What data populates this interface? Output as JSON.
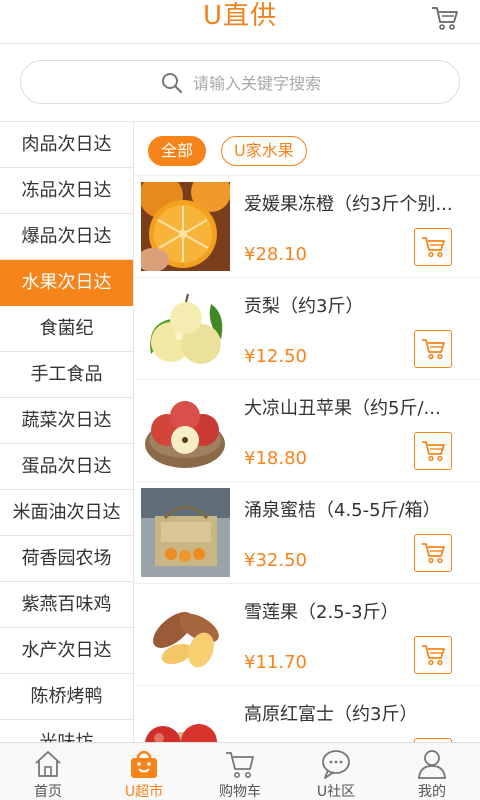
{
  "header": {
    "logo_text": "U直供",
    "cart_icon": "cart-icon"
  },
  "search": {
    "placeholder": "请输入关键字搜索",
    "icon": "search-icon"
  },
  "sidebar": {
    "active_index": 3,
    "items": [
      {
        "label": "肉品次日达"
      },
      {
        "label": "冻品次日达"
      },
      {
        "label": "爆品次日达"
      },
      {
        "label": "水果次日达"
      },
      {
        "label": "食菌纪"
      },
      {
        "label": "手工食品"
      },
      {
        "label": "蔬菜次日达"
      },
      {
        "label": "蛋品次日达"
      },
      {
        "label": "米面油次日达"
      },
      {
        "label": "荷香园农场"
      },
      {
        "label": "紫燕百味鸡"
      },
      {
        "label": "水产次日达"
      },
      {
        "label": "陈桥烤鸭"
      },
      {
        "label": "光味坊"
      }
    ]
  },
  "filters": {
    "all_label": "全部",
    "sub_label": "U家水果"
  },
  "products": [
    {
      "name": "爱媛果冻橙（约3斤个别...",
      "price": "¥28.10",
      "image": "orange"
    },
    {
      "name": "贡梨（约3斤）",
      "price": "¥12.50",
      "image": "pear"
    },
    {
      "name": "大凉山丑苹果（约5斤/...",
      "price": "¥18.80",
      "image": "apple"
    },
    {
      "name": "涌泉蜜桔（4.5-5斤/箱）",
      "price": "¥32.50",
      "image": "tangerine-box"
    },
    {
      "name": "雪莲果（2.5-3斤）",
      "price": "¥11.70",
      "image": "yacon"
    },
    {
      "name": "高原红富士（约3斤）",
      "price": "",
      "image": "red-apple"
    }
  ],
  "bottom_nav": {
    "active_index": 1,
    "items": [
      {
        "label": "首页",
        "icon": "home-icon"
      },
      {
        "label": "U超市",
        "icon": "shopping-bag-icon"
      },
      {
        "label": "购物车",
        "icon": "cart-icon"
      },
      {
        "label": "U社区",
        "icon": "chat-bubble-icon"
      },
      {
        "label": "我的",
        "icon": "user-icon"
      }
    ]
  },
  "colors": {
    "accent": "#f7831b",
    "text": "#333333",
    "muted": "#a8a8a8"
  }
}
